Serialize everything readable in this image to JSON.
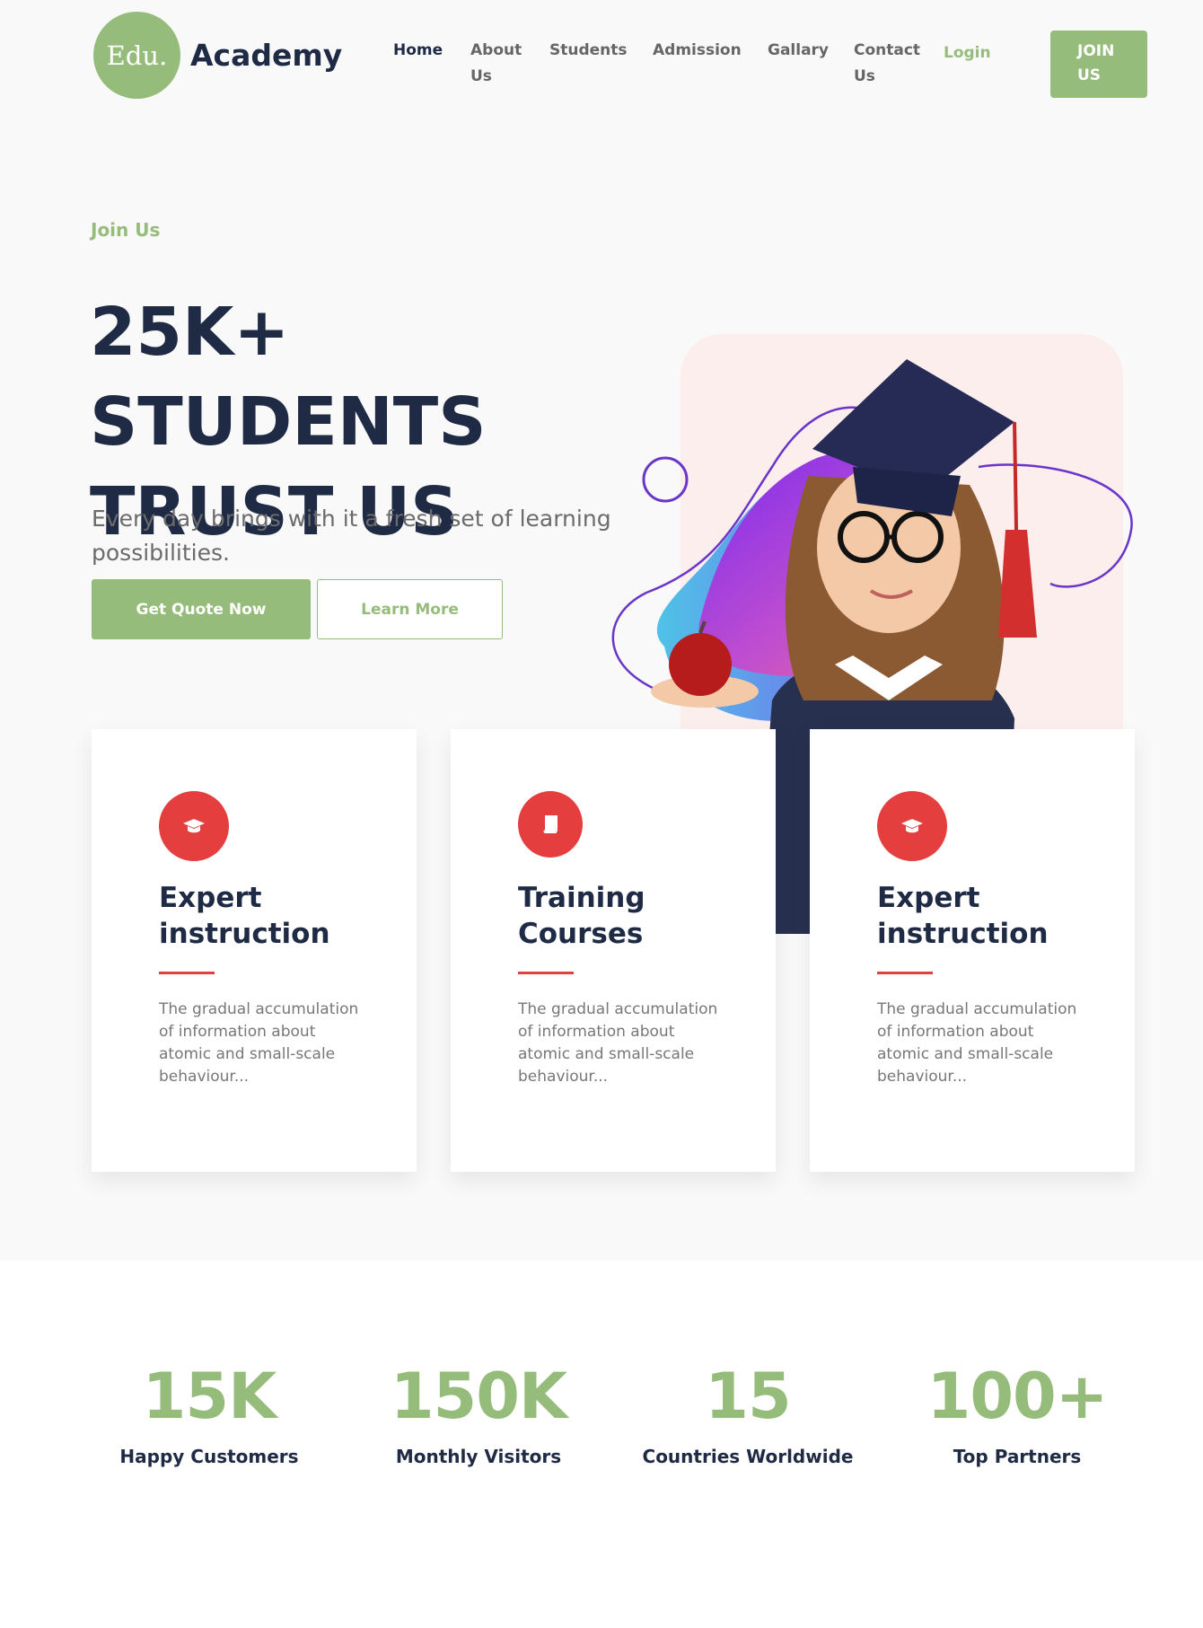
{
  "brand": {
    "logo_mark": "Edu.",
    "name": "Academy"
  },
  "nav": {
    "home": "Home",
    "about_line1": "About",
    "about_line2": "Us",
    "students": "Students",
    "admission": "Admission",
    "gallery": "Gallary",
    "contact_line1": "Contact",
    "contact_line2": "Us",
    "login": "Login",
    "join_line1": "JOIN",
    "join_line2": "US"
  },
  "hero": {
    "eyebrow": "Join Us",
    "title_line1": "25K+ STUDENTS",
    "title_line2": "TRUST US",
    "subtitle": "Every day brings with it a fresh set of learning possibilities.",
    "primary_button": "Get Quote Now",
    "secondary_button": "Learn More"
  },
  "features": [
    {
      "icon": "graduation-cap-icon",
      "title_line1": "Expert",
      "title_line2": "instruction",
      "description": "The gradual accumulation of information about atomic and small-scale behaviour..."
    },
    {
      "icon": "book-icon",
      "title_line1": "Training",
      "title_line2": "Courses",
      "description": "The gradual accumulation of information about atomic and small-scale behaviour..."
    },
    {
      "icon": "graduation-cap-icon",
      "title_line1": "Expert",
      "title_line2": "instruction",
      "description": "The gradual accumulation of information about atomic and small-scale behaviour..."
    }
  ],
  "stats": [
    {
      "value": "15K",
      "label": "Happy Customers"
    },
    {
      "value": "150K",
      "label": "Monthly Visitors"
    },
    {
      "value": "15",
      "label": "Countries Worldwide"
    },
    {
      "value": "100+",
      "label": "Top Partners"
    }
  ],
  "colors": {
    "accent": "#96bc7b",
    "navy": "#1f2a44",
    "red": "#e53e3e",
    "muted": "#6b6b6b"
  }
}
